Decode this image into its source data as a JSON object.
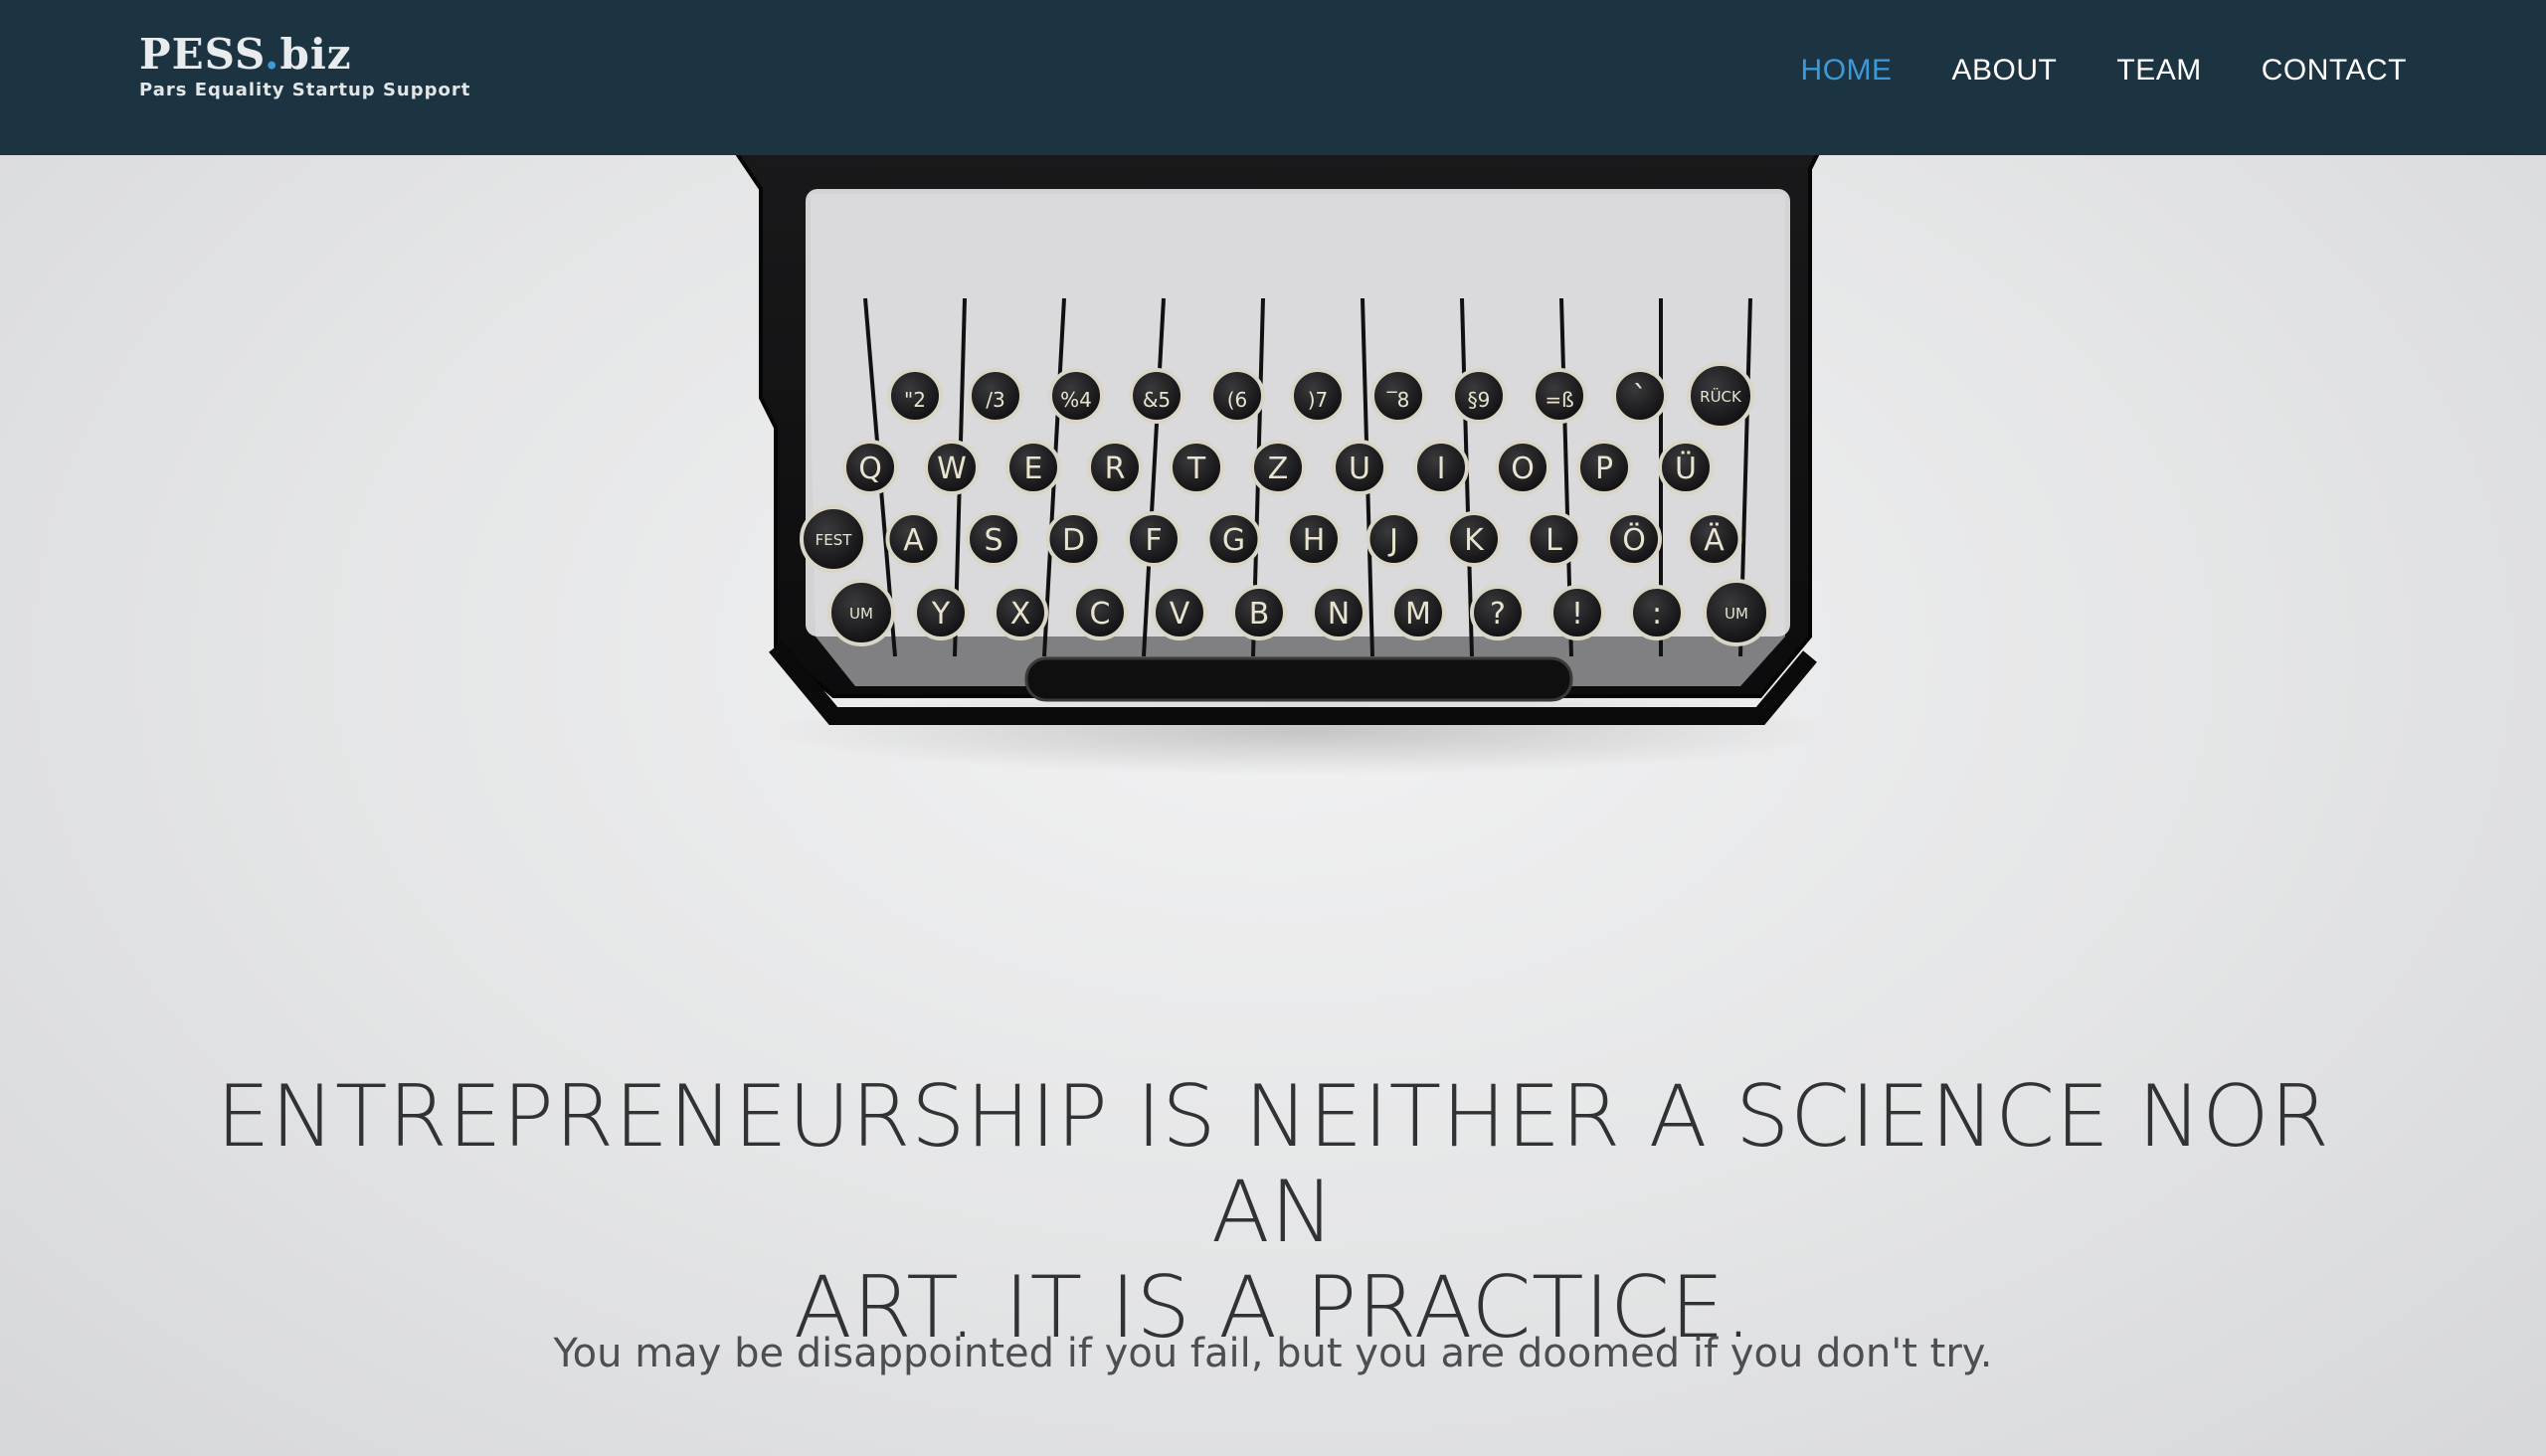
{
  "brand": {
    "name_main": "PESS",
    "name_dot": ".",
    "name_tld": "biz",
    "tagline": "Pars Equality Startup Support"
  },
  "nav": {
    "items": [
      {
        "label": "HOME",
        "active": true
      },
      {
        "label": "ABOUT",
        "active": false
      },
      {
        "label": "TEAM",
        "active": false
      },
      {
        "label": "CONTACT",
        "active": false
      }
    ]
  },
  "hero": {
    "headline_line1": "ENTREPRENEURSHIP IS NEITHER A SCIENCE NOR AN",
    "headline_line2": "ART. IT IS A PRACTICE.",
    "subline": "You may be disappointed if you fail, but you are doomed if you don't try.",
    "image_alt": "typewriter-photo",
    "typewriter_keys": {
      "row1": [
        "\"2",
        "/3",
        "%4",
        "&5",
        "(6",
        ")7",
        "‾8",
        "§9",
        "=ß",
        "`",
        "RÜCK"
      ],
      "row2": [
        "Q",
        "W",
        "E",
        "R",
        "T",
        "Z",
        "U",
        "I",
        "O",
        "P",
        "Ü"
      ],
      "row3": [
        "FEST",
        "A",
        "S",
        "D",
        "F",
        "G",
        "H",
        "J",
        "K",
        "L",
        "Ö",
        "Ä"
      ],
      "row4": [
        "UM",
        "Y",
        "X",
        "C",
        "V",
        "B",
        "N",
        "M",
        "?",
        "!",
        ":",
        "UM"
      ]
    }
  },
  "colors": {
    "navbar_bg": "#1c3441",
    "accent": "#3d9ad8",
    "headline": "#303233",
    "page_bg": "#e6e7e8"
  }
}
